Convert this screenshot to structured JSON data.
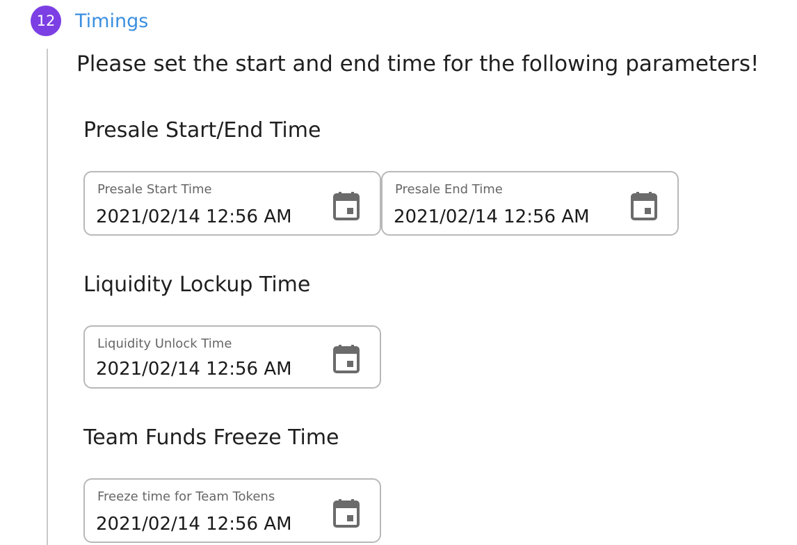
{
  "step": {
    "number": "12",
    "title": "Timings"
  },
  "instruction": "Please set the start and end time for the following parameters!",
  "sections": [
    {
      "title": "Presale Start/End Time",
      "fields": [
        {
          "label": "Presale Start Time",
          "value": "2021/02/14 12:56 AM",
          "icon": "calendar-icon"
        },
        {
          "label": "Presale End Time",
          "value": "2021/02/14 12:56 AM",
          "icon": "calendar-icon"
        }
      ]
    },
    {
      "title": "Liquidity Lockup Time",
      "fields": [
        {
          "label": "Liquidity Unlock Time",
          "value": "2021/02/14 12:56 AM",
          "icon": "calendar-icon"
        }
      ]
    },
    {
      "title": "Team Funds Freeze Time",
      "fields": [
        {
          "label": "Freeze time for Team Tokens",
          "value": "2021/02/14 12:56 AM",
          "icon": "calendar-icon"
        }
      ]
    }
  ],
  "colors": {
    "step_badge": "#7b3fe4",
    "step_title": "#3b8fe0",
    "field_border": "#b8b8b8",
    "icon": "#6b6b6b"
  }
}
